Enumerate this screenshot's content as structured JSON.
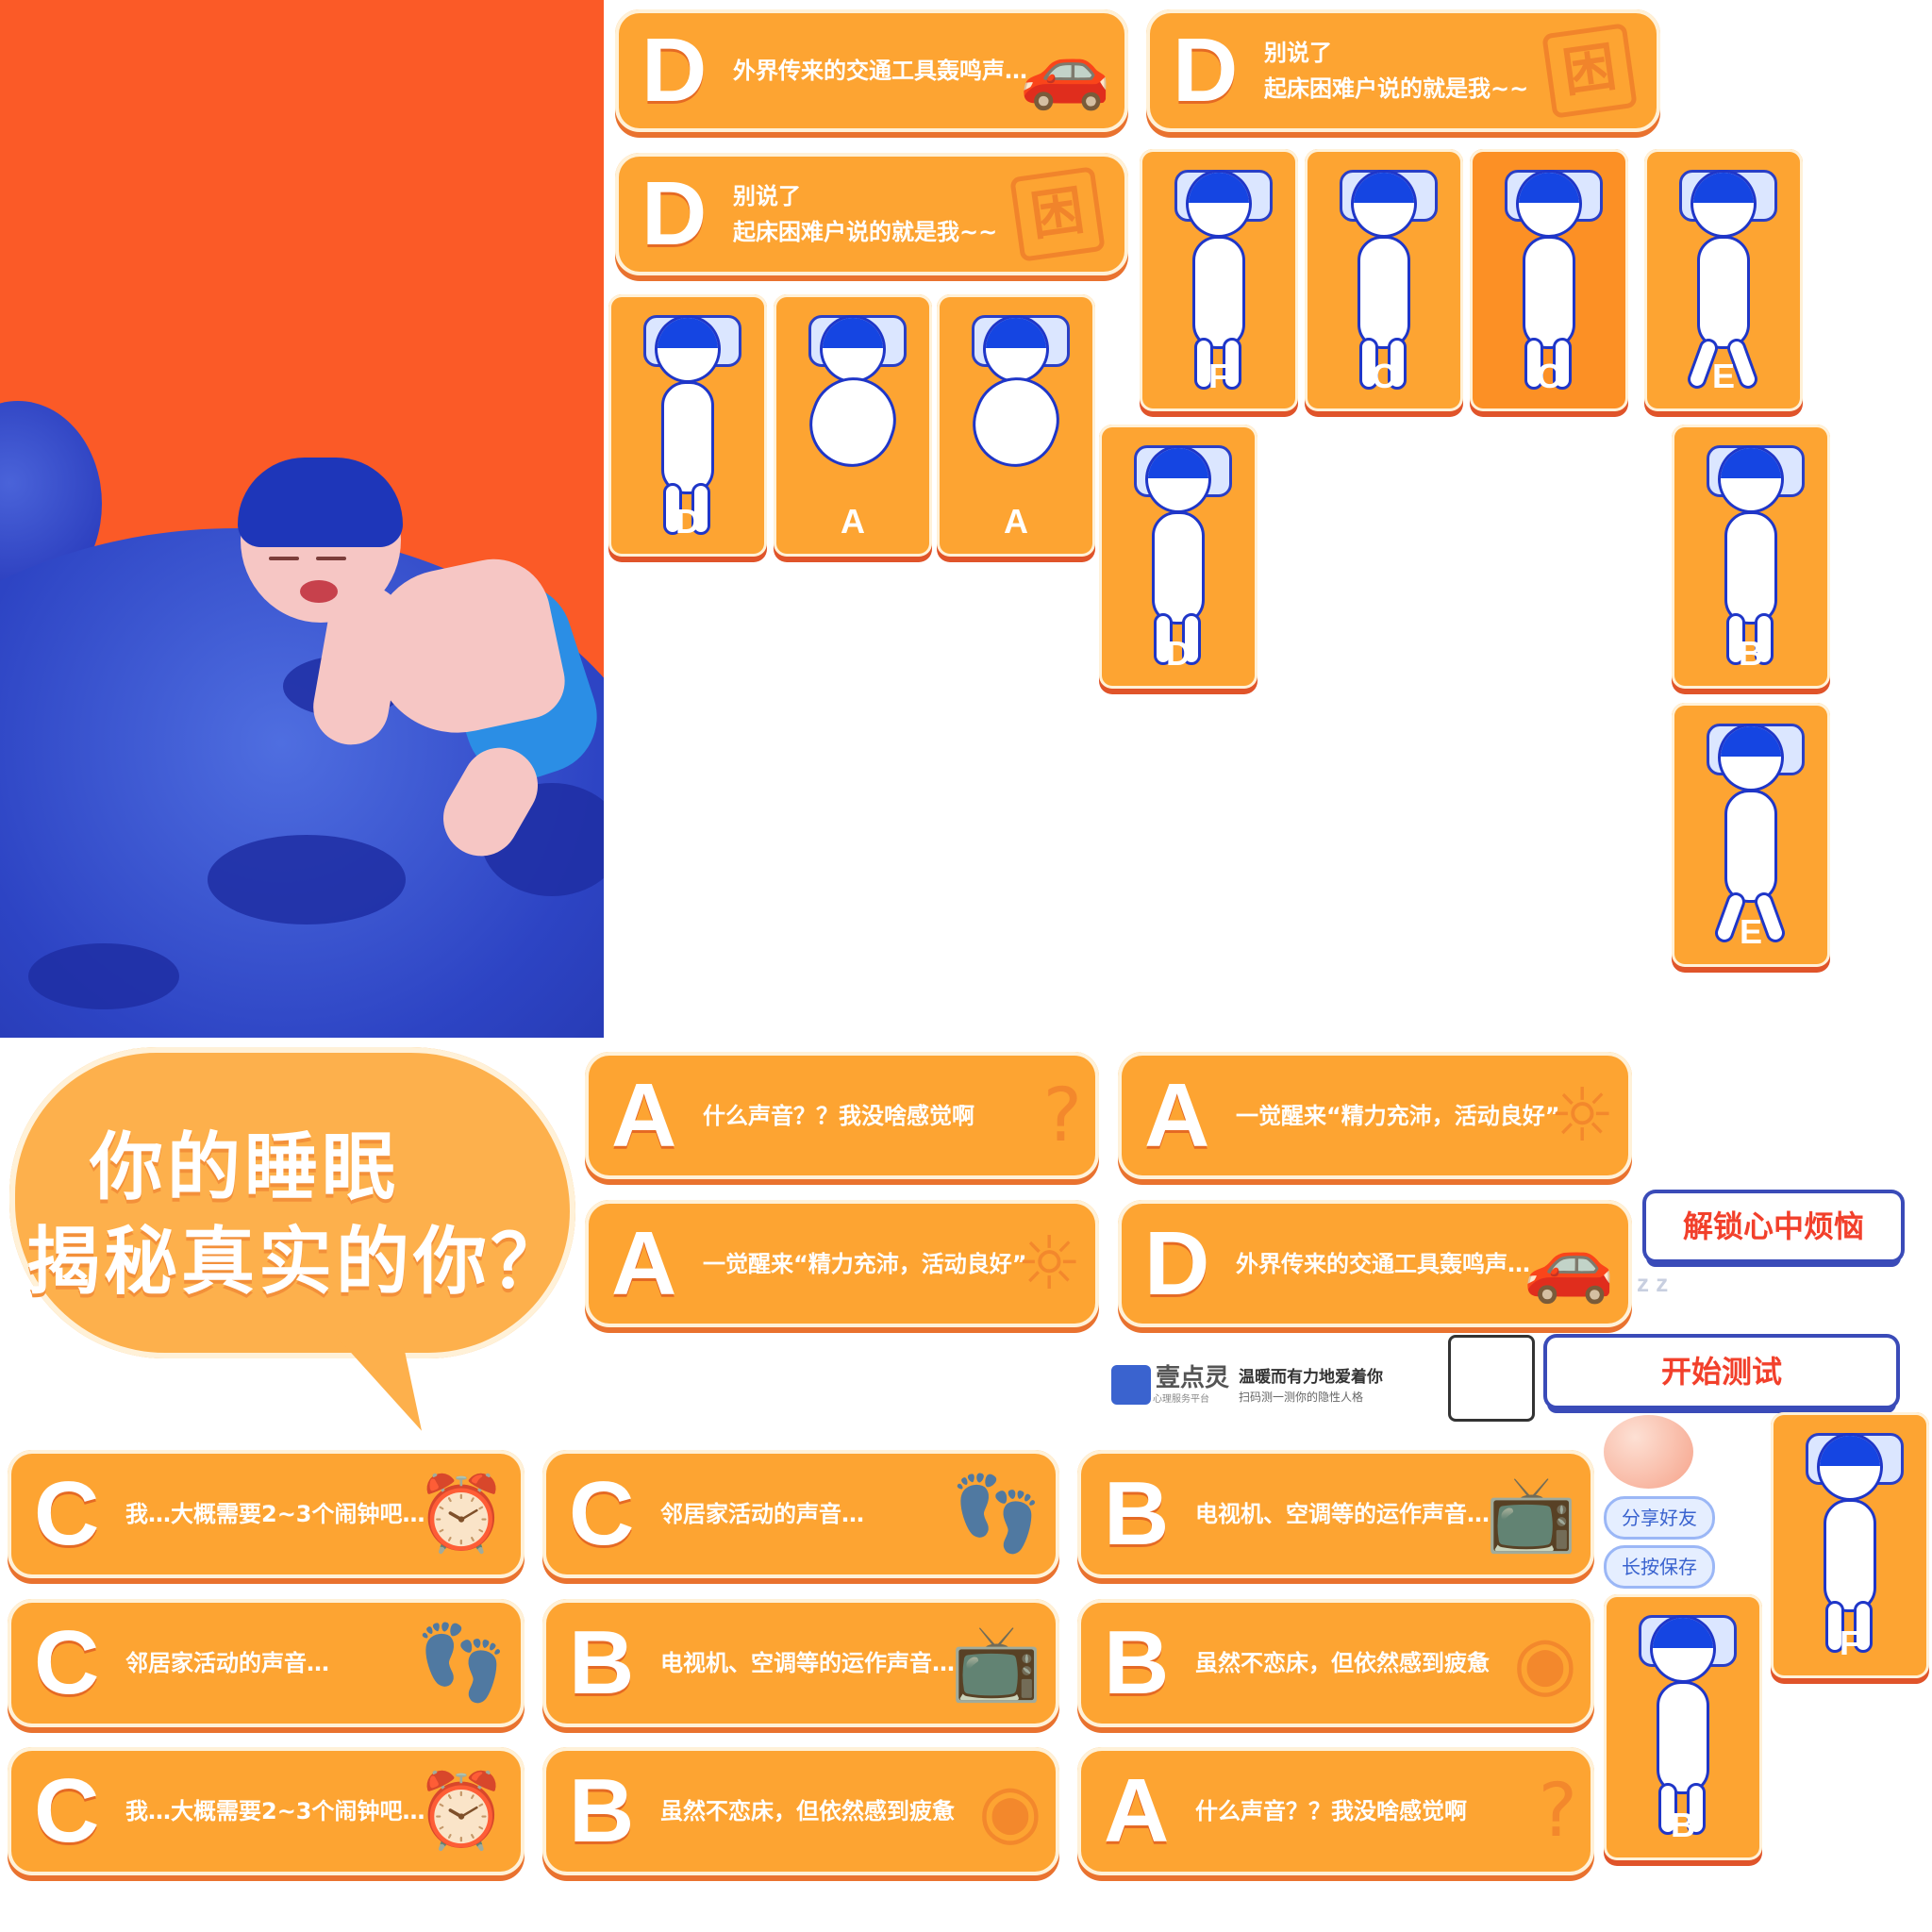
{
  "illustration": {
    "description_icon": "sleeping-boy-on-planet-illustration"
  },
  "title": {
    "line1": "你的睡眠",
    "line2": "揭秘真实的你？"
  },
  "cards": [
    {
      "letter": "D",
      "text": "外界传来的交通工具轰鸣声…",
      "icon": "car-icon"
    },
    {
      "letter": "D",
      "text": "别说了\n起床困难户说的就是我~~",
      "icon": "kun-stamp-icon",
      "stamp": "困"
    },
    {
      "letter": "D",
      "text": "别说了\n起床困难户说的就是我~~",
      "icon": "kun-stamp-icon",
      "stamp": "困"
    },
    {
      "letter": "A",
      "text": "什么声音？？我没啥感觉啊",
      "icon": "question-mark-icon"
    },
    {
      "letter": "A",
      "text": "一觉醒来“精力充沛，活动良好”",
      "icon": "sun-icon"
    },
    {
      "letter": "A",
      "text": "一觉醒来“精力充沛，活动良好”",
      "icon": "sun-icon"
    },
    {
      "letter": "D",
      "text": "外界传来的交通工具轰鸣声…",
      "icon": "car-icon"
    },
    {
      "letter": "C",
      "text": "我…大概需要2~3个闹钟吧…",
      "icon": "alarm-clock-icon"
    },
    {
      "letter": "C",
      "text": "邻居家活动的声音…",
      "icon": "footprint-icon"
    },
    {
      "letter": "B",
      "text": "电视机、空调等的运作声音…",
      "icon": "tv-icon"
    },
    {
      "letter": "C",
      "text": "邻居家活动的声音…",
      "icon": "footprint-icon"
    },
    {
      "letter": "B",
      "text": "电视机、空调等的运作声音…",
      "icon": "tv-icon"
    },
    {
      "letter": "B",
      "text": "虽然不恋床，但依然感到疲惫",
      "icon": "tired-eye-icon"
    },
    {
      "letter": "C",
      "text": "我…大概需要2~3个闹钟吧…",
      "icon": "alarm-clock-icon"
    },
    {
      "letter": "B",
      "text": "虽然不恋床，但依然感到疲惫",
      "icon": "tired-eye-icon"
    },
    {
      "letter": "A",
      "text": "什么声音？？我没啥感觉啊",
      "icon": "question-mark-icon"
    }
  ],
  "tiles": [
    {
      "letter": "F",
      "pose": "hands-behind-head"
    },
    {
      "letter": "C",
      "pose": "side"
    },
    {
      "letter": "C",
      "pose": "side"
    },
    {
      "letter": "E",
      "pose": "starfish"
    },
    {
      "letter": "D",
      "pose": "straight"
    },
    {
      "letter": "A",
      "pose": "fetal"
    },
    {
      "letter": "A",
      "pose": "fetal"
    },
    {
      "letter": "D",
      "pose": "straight"
    },
    {
      "letter": "B",
      "pose": "side-straight"
    },
    {
      "letter": "E",
      "pose": "starfish"
    },
    {
      "letter": "F",
      "pose": "hands-behind-head"
    },
    {
      "letter": "B",
      "pose": "side-straight"
    }
  ],
  "buttons": {
    "unlock": "解锁心中烦恼",
    "start": "开始测试",
    "share": "分享好友",
    "save": "长按保存"
  },
  "brand": {
    "logo_text": "壹点灵",
    "logo_sub": "心理服务平台",
    "slogan": "温暖而有力地爱着你",
    "sub_slogan": "扫码测一测你的隐性人格"
  },
  "colors": {
    "orange": "#fb5a27",
    "card": "#fda432",
    "blue": "#1f36c8",
    "red_text": "#f2402b"
  }
}
